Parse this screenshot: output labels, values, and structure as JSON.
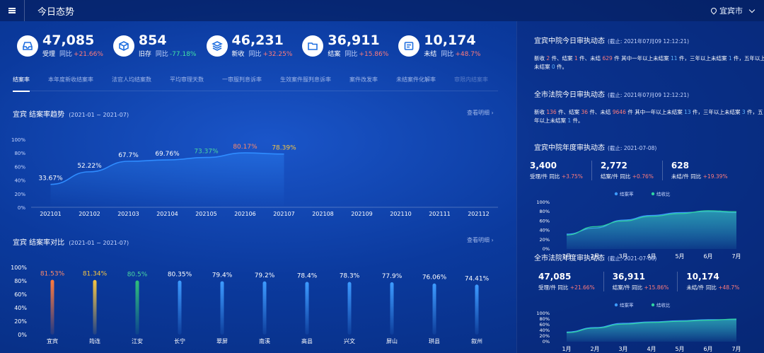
{
  "header": {
    "title": "今日态势",
    "region": "宜宾市"
  },
  "kpis": [
    {
      "value": "47,085",
      "label": "受理",
      "yoy_label": "同比",
      "yoy": "+21.66%",
      "trend": "up",
      "icon": "inbox-icon"
    },
    {
      "value": "854",
      "label": "旧存",
      "yoy_label": "同比",
      "yoy": "-77.18%",
      "trend": "down",
      "icon": "box-icon"
    },
    {
      "value": "46,231",
      "label": "新收",
      "yoy_label": "同比",
      "yoy": "+32.25%",
      "trend": "up",
      "icon": "layers-icon"
    },
    {
      "value": "36,911",
      "label": "结案",
      "yoy_label": "同比",
      "yoy": "+15.86%",
      "trend": "up",
      "icon": "folder-icon"
    },
    {
      "value": "10,174",
      "label": "未结",
      "yoy_label": "同比",
      "yoy": "+48.7%",
      "trend": "up",
      "icon": "file-pending-icon"
    }
  ],
  "tabs": [
    "结案率",
    "本年度新收结案率",
    "法官人均结案数",
    "平均审理天数",
    "一审服判息诉率",
    "生效案件服判息诉率",
    "案件改发率",
    "未结案件化解率",
    "审限内结案率"
  ],
  "trend": {
    "title": "宜宾 结案率趋势",
    "range": "(2021-01 ~ 2021-07)",
    "detail": "查看明细",
    "y_ticks": [
      "100%",
      "80%",
      "60%",
      "40%",
      "20%",
      "0%"
    ]
  },
  "compare": {
    "title": "宜宾 结案率对比",
    "range": "(2021-01 ~ 2021-07)",
    "detail": "查看明细",
    "y_ticks": [
      "100%",
      "80%",
      "60%",
      "40%",
      "20%",
      "0%"
    ]
  },
  "chart_data": [
    {
      "type": "line",
      "categories": [
        "202101",
        "202102",
        "202103",
        "202104",
        "202105",
        "202106",
        "202107",
        "202108",
        "202109",
        "202110",
        "202111",
        "202112"
      ],
      "values": [
        33.67,
        52.22,
        67.7,
        69.76,
        73.37,
        80.17,
        78.39,
        null,
        null,
        null,
        null,
        null
      ],
      "labels": [
        "33.67%",
        "52.22%",
        "67.7%",
        "69.76%",
        "73.37%",
        "80.17%",
        "78.39%"
      ],
      "label_colors": [
        "#ffffff",
        "#ffffff",
        "#ffffff",
        "#ffffff",
        "#4ad7a0",
        "#ff8a6a",
        "#f5c542"
      ],
      "line_color": "#2f8cff",
      "ylim": [
        0,
        100
      ]
    },
    {
      "type": "bar",
      "categories": [
        "宜宾",
        "筠连",
        "江安",
        "长宁",
        "翠屏",
        "南溪",
        "高县",
        "兴文",
        "屏山",
        "珙县",
        "叙州"
      ],
      "values": [
        81.53,
        81.34,
        80.5,
        80.35,
        79.4,
        79.2,
        78.4,
        78.3,
        77.9,
        76.06,
        74.41
      ],
      "labels": [
        "81.53%",
        "81.34%",
        "80.5%",
        "80.35%",
        "79.4%",
        "79.2%",
        "78.4%",
        "78.3%",
        "77.9%",
        "76.06%",
        "74.41%"
      ],
      "colors": [
        "#ff7a3d",
        "#f5c542",
        "#2fbf7a",
        "#3d9bff",
        "#3d9bff",
        "#3d9bff",
        "#3d9bff",
        "#3d9bff",
        "#3d9bff",
        "#3d9bff",
        "#3d9bff"
      ],
      "label_colors": [
        "#ff8a6a",
        "#f5c542",
        "#4ad7a0",
        "#ffffff",
        "#ffffff",
        "#ffffff",
        "#ffffff",
        "#ffffff",
        "#ffffff",
        "#ffffff",
        "#ffffff"
      ],
      "ylim": [
        0,
        100
      ]
    },
    {
      "type": "area",
      "categories": [
        "1月",
        "2月",
        "3月",
        "4月",
        "5月",
        "6月",
        "7月"
      ],
      "series": [
        {
          "name": "结案率",
          "values": [
            32,
            45,
            62,
            72,
            78,
            80,
            78
          ],
          "color": "#3d9bff"
        },
        {
          "name": "结收比",
          "values": [
            30,
            48,
            60,
            70,
            76,
            82,
            80
          ],
          "color": "#2fd4a0"
        }
      ],
      "y_ticks": [
        "100%",
        "80%",
        "60%",
        "40%",
        "20%",
        "0%"
      ],
      "ylim": [
        0,
        100
      ]
    },
    {
      "type": "area",
      "categories": [
        "1月",
        "2月",
        "3月",
        "4月",
        "5月",
        "6月",
        "7月"
      ],
      "series": [
        {
          "name": "结案率",
          "values": [
            34,
            50,
            65,
            70,
            74,
            78,
            78
          ],
          "color": "#3d9bff"
        },
        {
          "name": "结收比",
          "values": [
            32,
            48,
            62,
            68,
            72,
            76,
            80
          ],
          "color": "#2fd4a0"
        }
      ],
      "y_ticks": [
        "100%",
        "80%",
        "60%",
        "40%",
        "20%",
        "0%"
      ],
      "ylim": [
        0,
        100
      ]
    }
  ],
  "right": {
    "today_mid": {
      "title": "宜宾中院今日审执动态",
      "asof": "(截止: 2021年07月09 12:12:21)",
      "p1": "新收",
      "n1": "2",
      "p2": "件、结案",
      "n2": "1",
      "p3": "件、未结",
      "n3": "629",
      "p4": "件 其中一年以上未结案",
      "n4": "11",
      "p5": "件，三年以上未结案",
      "n5": "1",
      "p6": "件，五年以上未结案",
      "n6": "0",
      "p7": "件。"
    },
    "today_city": {
      "title": "全市法院今日审执动态",
      "asof": "(截止: 2021年07月09 12:12:21)",
      "p1": "新收",
      "n1": "136",
      "p2": "件、结案",
      "n2": "36",
      "p3": "件、未结",
      "n3": "9646",
      "p4": "件 其中一年以上未结案",
      "n4": "13",
      "p5": "件，三年以上未结案",
      "n5": "3",
      "p6": "件，五年以上未结案",
      "n6": "1",
      "p7": "件。"
    },
    "year_mid": {
      "title": "宜宾中院年度审执动态",
      "asof": "(截止: 2021-07-08)",
      "kpis": [
        {
          "value": "3,400",
          "label": "受理/件",
          "yoy_label": "同比",
          "yoy": "+3.75%"
        },
        {
          "value": "2,772",
          "label": "结案/件",
          "yoy_label": "同比",
          "yoy": "+0.76%"
        },
        {
          "value": "628",
          "label": "未结/件",
          "yoy_label": "同比",
          "yoy": "+19.39%"
        }
      ]
    },
    "year_city": {
      "title": "全市法院年度审执动态",
      "asof": "(截止: 2021-07-08)",
      "kpis": [
        {
          "value": "47,085",
          "label": "受理/件",
          "yoy_label": "同比",
          "yoy": "+21.66%"
        },
        {
          "value": "36,911",
          "label": "结案/件",
          "yoy_label": "同比",
          "yoy": "+15.86%"
        },
        {
          "value": "10,174",
          "label": "未结/件",
          "yoy_label": "同比",
          "yoy": "+48.7%"
        }
      ]
    }
  }
}
